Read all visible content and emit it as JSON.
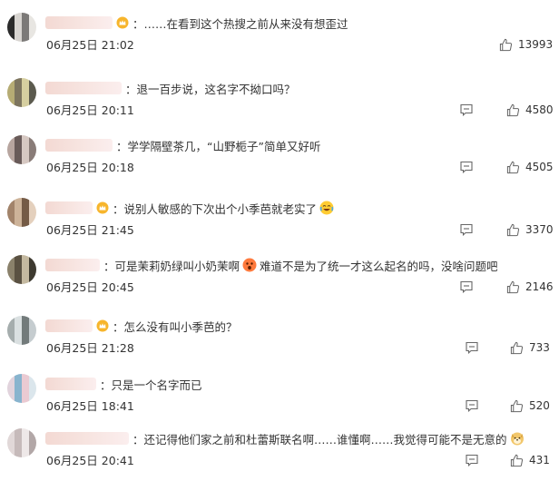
{
  "comments": [
    {
      "name": "",
      "has_crown": true,
      "text": "：……在看到这个热搜之前从来没有想歪过",
      "date": "06月25日 21:02",
      "likes": "13993",
      "emoji": ""
    },
    {
      "name": "",
      "has_crown": false,
      "text": "：退一百步说，这名字不拗口吗？",
      "date": "06月25日 20:11",
      "likes": "4580",
      "emoji": ""
    },
    {
      "name": "",
      "has_crown": false,
      "text": "：学学隔壁茶几，“山野栀子”简单又好听",
      "date": "06月25日 20:18",
      "likes": "4505",
      "emoji": ""
    },
    {
      "name": "",
      "has_crown": true,
      "text": "：说别人敏感的下次出个小季芭就老实了",
      "date": "06月25日 21:45",
      "likes": "3370",
      "emoji": "laugh-cry-emoji"
    },
    {
      "name": "",
      "has_crown": false,
      "text": "：可是茉莉奶绿叫小奶茉啊",
      "text2": "难道不是为了统一才这么起名的吗，没啥问题吧",
      "date": "06月25日 20:45",
      "likes": "2146",
      "emoji": "surprised-emoji"
    },
    {
      "name": "",
      "has_crown": true,
      "text": "：怎么没有叫小季芭的？",
      "date": "06月25日 21:28",
      "likes": "733",
      "emoji": ""
    },
    {
      "name": "",
      "has_crown": false,
      "text": "：只是一个名字而已",
      "date": "06月25日 18:41",
      "likes": "520",
      "emoji": ""
    },
    {
      "name": "",
      "has_crown": false,
      "text": "：还记得他们家之前和杜蕾斯联名啊……谁懂啊……我觉得可能不是无意的",
      "date": "06月25日 20:41",
      "likes": "431",
      "emoji": "doge-emoji"
    }
  ],
  "icons": {
    "reply": "comment-icon",
    "like": "thumbs-up-icon",
    "crown": "crown-badge-icon"
  },
  "colors": {
    "text": "#333333",
    "icon": "#666666",
    "crown": "#f5a623"
  }
}
